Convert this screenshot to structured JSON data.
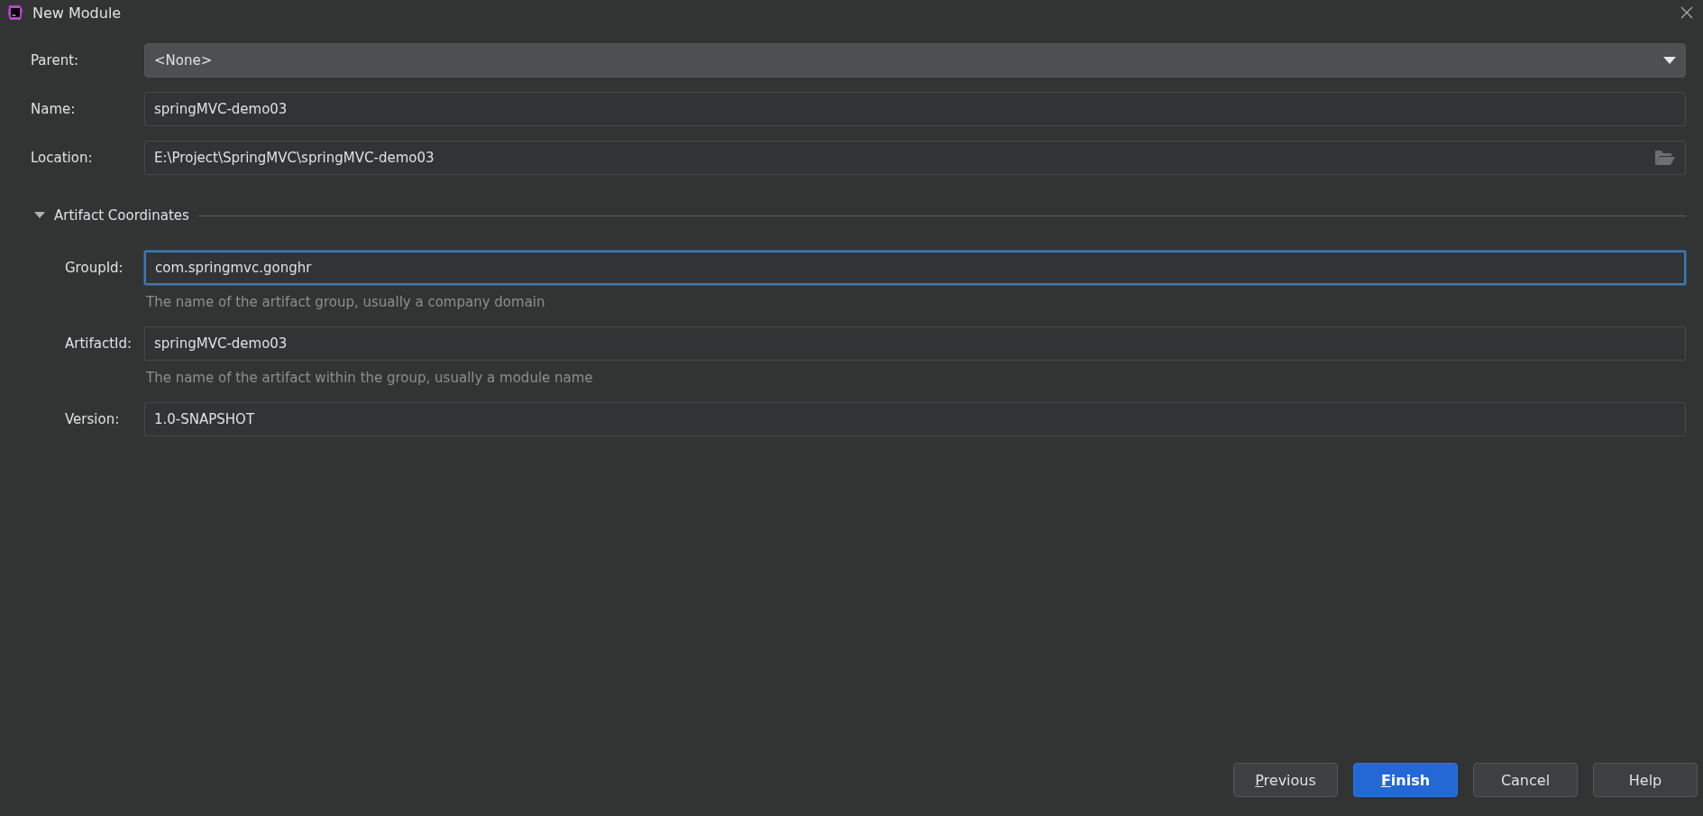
{
  "window": {
    "title": "New Module"
  },
  "fields": [
    {
      "kind": "dropdown",
      "label": "Parent:",
      "value": "<None>"
    },
    {
      "kind": "text",
      "label": "Name:",
      "value": "springMVC-demo03"
    },
    {
      "kind": "path",
      "label": "Location:",
      "value": "E:\\Project\\SpringMVC\\springMVC-demo03"
    }
  ],
  "artifact_section": {
    "title": "Artifact Coordinates",
    "expanded": true,
    "fields": [
      {
        "label": "GroupId:",
        "value": "com.springmvc.gonghr",
        "focused": true,
        "hint": "The name of the artifact group, usually a company domain"
      },
      {
        "label": "ArtifactId:",
        "value": "springMVC-demo03",
        "focused": false,
        "hint": "The name of the artifact within the group, usually a module name"
      },
      {
        "label": "Version:",
        "value": "1.0-SNAPSHOT",
        "focused": false
      }
    ]
  },
  "buttons": [
    {
      "label": "Previous",
      "default": false,
      "mnemonic": true
    },
    {
      "label": "Finish",
      "default": true,
      "mnemonic": true
    },
    {
      "label": "Cancel",
      "default": false,
      "mnemonic": false
    },
    {
      "label": "Help",
      "default": false,
      "mnemonic": false
    }
  ]
}
